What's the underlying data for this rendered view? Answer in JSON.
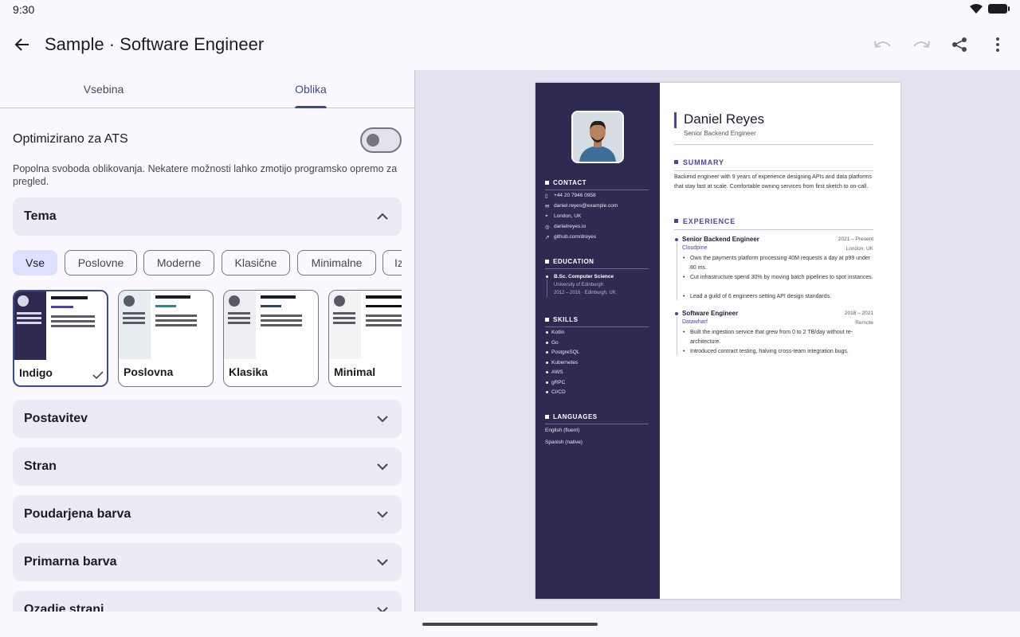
{
  "status": {
    "time": "9:30"
  },
  "appbar": {
    "title": "Sample · Software Engineer"
  },
  "tabs": [
    {
      "label": "Vsebina"
    },
    {
      "label": "Oblika"
    }
  ],
  "ats": {
    "label": "Optimizirano za ATS",
    "enabled": false,
    "description": "Popolna svoboda oblikovanja. Nekatere možnosti lahko zmotijo programsko opremo za pregled."
  },
  "theme_section": {
    "title": "Tema"
  },
  "filters": [
    "Vse",
    "Poslovne",
    "Moderne",
    "Klasične",
    "Minimalne",
    "Iz"
  ],
  "templates": [
    {
      "label": "Indigo",
      "selected": true
    },
    {
      "label": "Poslovna",
      "selected": false
    },
    {
      "label": "Klasika",
      "selected": false
    },
    {
      "label": "Minimal",
      "selected": false
    }
  ],
  "sections": [
    "Postavitev",
    "Stran",
    "Poudarjena barva",
    "Primarna barva",
    "Ozadje strani"
  ],
  "colors": {
    "accent": "#3f4a8a",
    "sidebar": "#2e2a52",
    "resume_accent": "#4c44a0"
  },
  "resume": {
    "name": "Daniel Reyes",
    "role": "Senior Backend Engineer",
    "contact_title": "CONTACT",
    "contact": [
      "+44 20 7946 0958",
      "daniel.reyes@example.com",
      "London, UK",
      "danielreyes.io",
      "github.com/dreyes"
    ],
    "education_title": "EDUCATION",
    "education": {
      "degree": "B.Sc. Computer Science",
      "school": "University of Edinburgh",
      "years": "2012 – 2016 · Edinburgh, UK"
    },
    "skills_title": "SKILLS",
    "skills": [
      "Kotlin",
      "Go",
      "PostgreSQL",
      "Kubernetes",
      "AWS",
      "gRPC",
      "CI/CD"
    ],
    "languages_title": "LANGUAGES",
    "languages": [
      "English (fluent)",
      "Spanish (native)"
    ],
    "summary_title": "SUMMARY",
    "summary": "Backend engineer with 9 years of experience designing APIs and data platforms that stay fast at scale. Comfortable owning services from first sketch to on-call.",
    "experience_title": "EXPERIENCE",
    "jobs": [
      {
        "title": "Senior Backend Engineer",
        "dates": "2021 – Present",
        "company": "Cloudpine",
        "location": "London, UK",
        "bullets": [
          "Own the payments platform processing 40M requests a day at p99 under 80 ms.",
          "Cut infrastructure spend 30% by moving batch pipelines to spot instances.",
          "Lead a guild of 6 engineers setting API design standards."
        ]
      },
      {
        "title": "Software Engineer",
        "dates": "2018 – 2021",
        "company": "Datawharf",
        "location": "Remote",
        "bullets": [
          "Built the ingestion service that grew from 0 to 2 TB/day without re-architecture.",
          "Introduced contract testing, halving cross-team integration bugs."
        ]
      }
    ]
  }
}
